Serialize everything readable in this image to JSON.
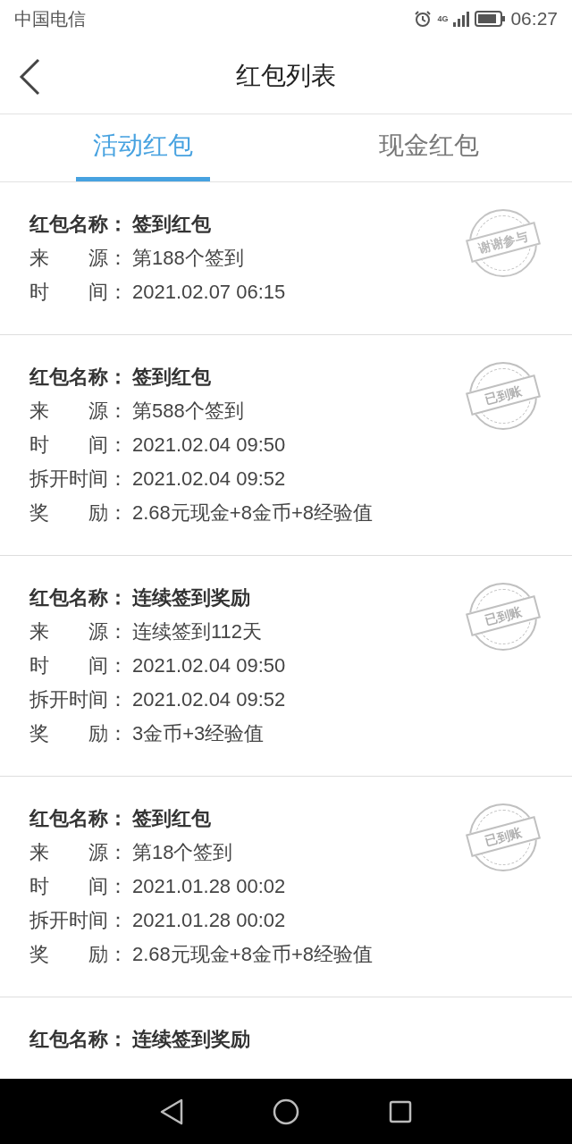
{
  "status_bar": {
    "carrier": "中国电信",
    "network": "4G",
    "time": "06:27"
  },
  "header": {
    "title": "红包列表"
  },
  "tabs": [
    {
      "label": "活动红包",
      "selected": true
    },
    {
      "label": "现金红包",
      "selected": false
    }
  ],
  "items": [
    {
      "fields": [
        {
          "label": "红包名称：",
          "value": "签到红包"
        },
        {
          "label": "来　　源：",
          "value": "第188个签到"
        },
        {
          "label": "时　　间：",
          "value": "2021.02.07 06:15"
        }
      ],
      "stamp": {
        "kind": "thanks",
        "text": "谢谢参与"
      }
    },
    {
      "fields": [
        {
          "label": "红包名称：",
          "value": "签到红包"
        },
        {
          "label": "来　　源：",
          "value": "第588个签到"
        },
        {
          "label": "时　　间：",
          "value": "2021.02.04 09:50"
        },
        {
          "label": "拆开时间：",
          "value": "2021.02.04 09:52"
        },
        {
          "label": "奖　　励：",
          "value": "2.68元现金+8金币+8经验值"
        }
      ],
      "stamp": {
        "kind": "credited",
        "text": "已到账"
      }
    },
    {
      "fields": [
        {
          "label": "红包名称：",
          "value": "连续签到奖励"
        },
        {
          "label": "来　　源：",
          "value": "连续签到112天"
        },
        {
          "label": "时　　间：",
          "value": "2021.02.04 09:50"
        },
        {
          "label": "拆开时间：",
          "value": "2021.02.04 09:52"
        },
        {
          "label": "奖　　励：",
          "value": "3金币+3经验值"
        }
      ],
      "stamp": {
        "kind": "credited",
        "text": "已到账"
      }
    },
    {
      "fields": [
        {
          "label": "红包名称：",
          "value": "签到红包"
        },
        {
          "label": "来　　源：",
          "value": "第18个签到"
        },
        {
          "label": "时　　间：",
          "value": "2021.01.28 00:02"
        },
        {
          "label": "拆开时间：",
          "value": "2021.01.28 00:02"
        },
        {
          "label": "奖　　励：",
          "value": "2.68元现金+8金币+8经验值"
        }
      ],
      "stamp": {
        "kind": "credited",
        "text": "已到账"
      }
    },
    {
      "fields": [
        {
          "label": "红包名称：",
          "value": "连续签到奖励"
        }
      ]
    }
  ]
}
